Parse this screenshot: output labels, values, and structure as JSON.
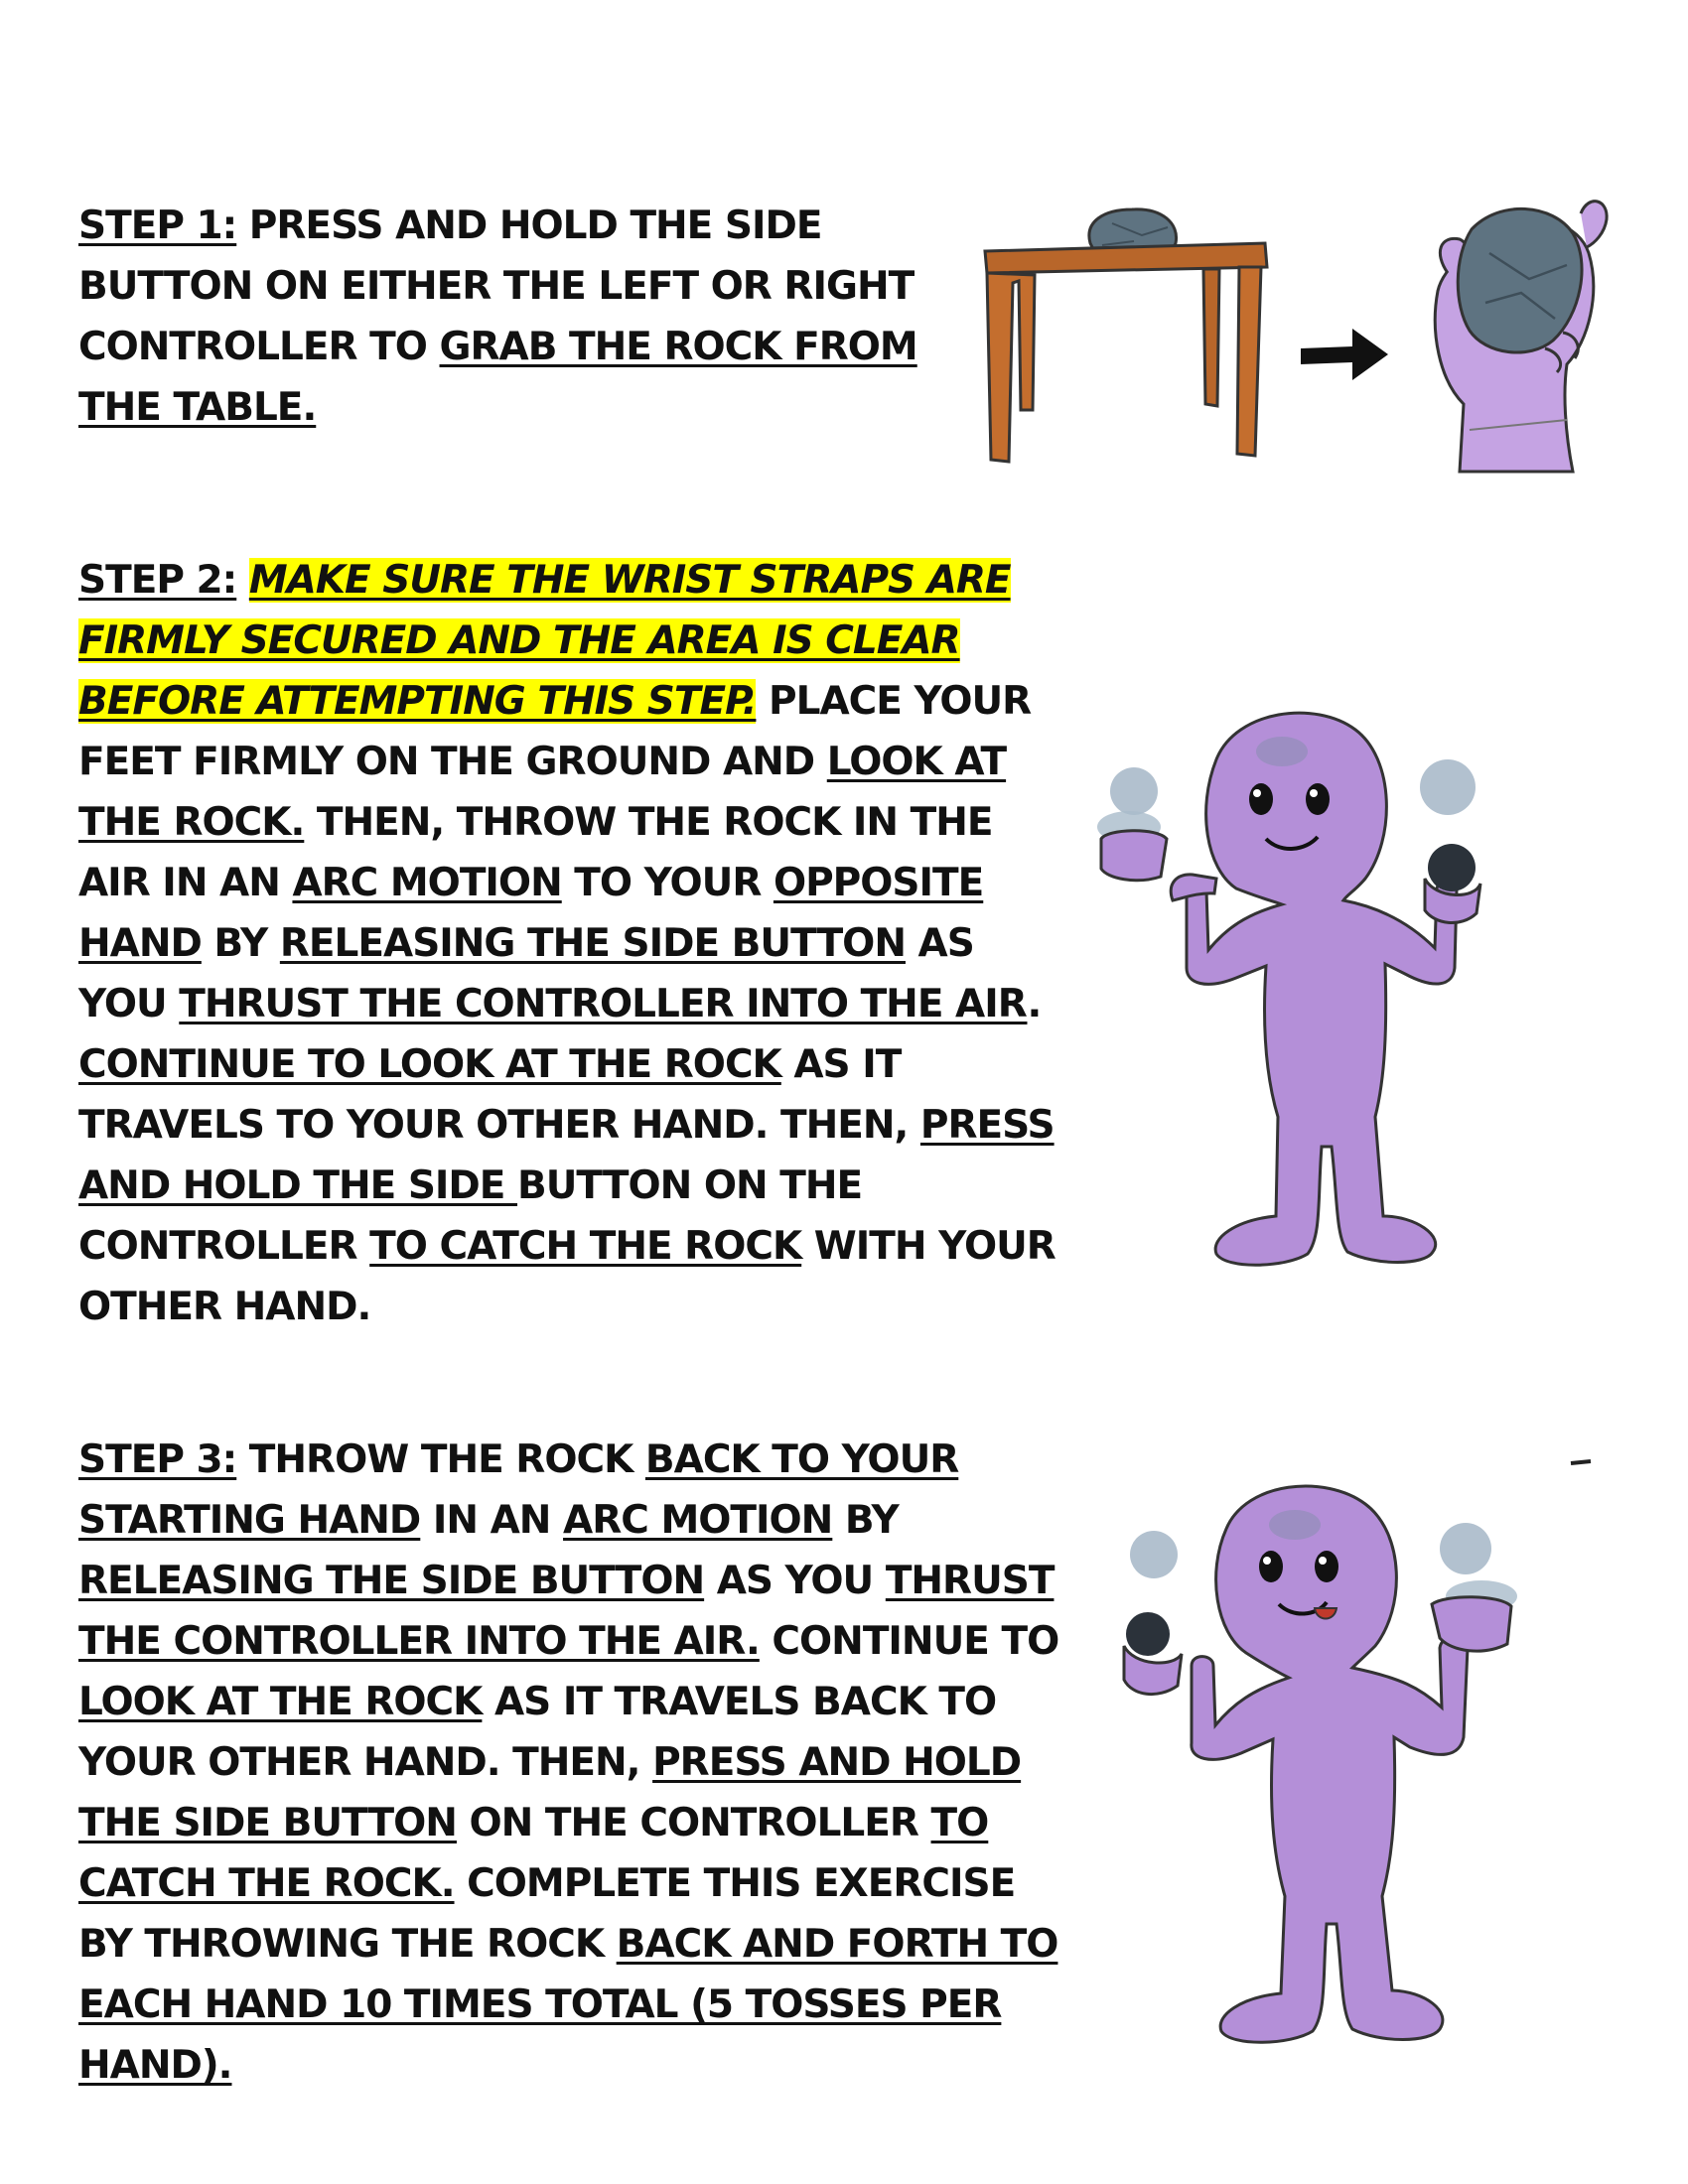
{
  "steps": [
    {
      "segments": [
        {
          "text": "STEP 1:",
          "u": true
        },
        {
          "text": " PRESS AND HOLD THE SIDE BUTTON ON EITHER THE LEFT OR RIGHT CONTROLLER TO ",
          "u": false
        },
        {
          "text": "GRAB THE ROCK FROM THE TABLE.",
          "u": true
        }
      ]
    },
    {
      "segments": [
        {
          "text": "STEP 2:",
          "u": true
        },
        {
          "text": " ",
          "u": false
        },
        {
          "text": "MAKE SURE THE WRIST STRAPS ARE FIRMLY SECURED AND THE AREA IS CLEAR BEFORE ATTEMPTING THIS STEP.",
          "u": true,
          "hl": true
        },
        {
          "text": " PLACE YOUR FEET FIRMLY ON THE GROUND AND ",
          "u": false
        },
        {
          "text": "LOOK AT THE ROCK.",
          "u": true
        },
        {
          "text": " THEN, THROW THE ROCK IN THE AIR IN AN ",
          "u": false
        },
        {
          "text": "ARC MOTION",
          "u": true
        },
        {
          "text": " TO YOUR ",
          "u": false
        },
        {
          "text": "OPPOSITE HAND",
          "u": true
        },
        {
          "text": " BY ",
          "u": false
        },
        {
          "text": "RELEASING THE SIDE BUTTON",
          "u": true
        },
        {
          "text": " AS YOU ",
          "u": false
        },
        {
          "text": "THRUST THE CONTROLLER INTO THE AIR",
          "u": true
        },
        {
          "text": ". ",
          "u": false
        },
        {
          "text": "CONTINUE TO LOOK AT THE ROCK",
          "u": true
        },
        {
          "text": " AS IT TRAVELS TO YOUR OTHER HAND. THEN, ",
          "u": false
        },
        {
          "text": "PRESS AND HOLD THE SIDE ",
          "u": true
        },
        {
          "text": "BUTTON ON THE CONTROLLER ",
          "u": false
        },
        {
          "text": "TO CATCH THE ROCK",
          "u": true
        },
        {
          "text": " WITH YOUR OTHER HAND.",
          "u": false
        }
      ]
    },
    {
      "segments": [
        {
          "text": "STEP 3:",
          "u": true
        },
        {
          "text": " THROW THE ROCK ",
          "u": false
        },
        {
          "text": "BACK TO YOUR STARTING HAND",
          "u": true
        },
        {
          "text": " IN AN ",
          "u": false
        },
        {
          "text": "ARC MOTION",
          "u": true
        },
        {
          "text": " BY ",
          "u": false
        },
        {
          "text": "RELEASING THE SIDE BUTTON",
          "u": true
        },
        {
          "text": " AS YOU ",
          "u": false
        },
        {
          "text": "THRUST THE CONTROLLER INTO THE AIR.",
          "u": true
        },
        {
          "text": " CONTINUE TO ",
          "u": false
        },
        {
          "text": "LOOK AT THE ROCK",
          "u": true
        },
        {
          "text": " AS IT TRAVELS BACK TO YOUR OTHER HAND. THEN, ",
          "u": false
        },
        {
          "text": "PRESS AND HOLD THE SIDE BUTTON",
          "u": true
        },
        {
          "text": " ON THE CONTROLLER ",
          "u": false
        },
        {
          "text": "TO CATCH THE ROCK.",
          "u": true
        },
        {
          "text": " COMPLETE THIS EXERCISE BY THROWING THE ROCK ",
          "u": false
        },
        {
          "text": "BACK AND FORTH TO EACH HAND 10 TIMES TOTAL (5 TOSSES PER HAND).",
          "u": true
        }
      ]
    }
  ],
  "colors": {
    "highlight": "#ffff00",
    "character": "#b48fd8",
    "rock": "#5e7381",
    "table": "#b8662a"
  }
}
